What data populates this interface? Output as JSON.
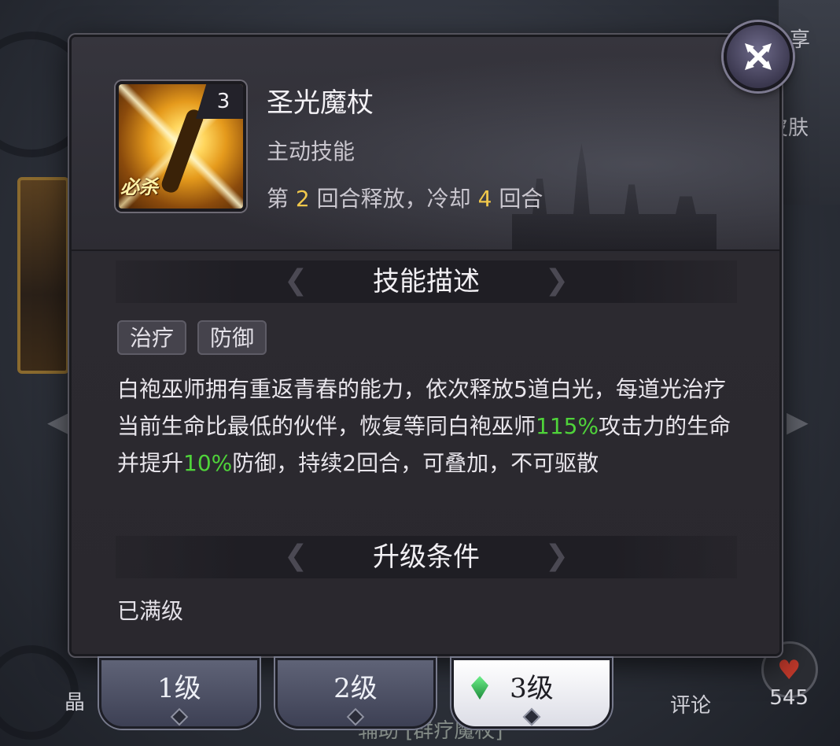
{
  "background": {
    "share_label": "享",
    "skin_label": "皮肤",
    "crystal_label": "晶",
    "comment_label": "评论",
    "likes_count": "545",
    "footer_text": "辅助 [群疗魔杖]"
  },
  "skill": {
    "name": "圣光魔杖",
    "type": "主动技能",
    "level_badge": "3",
    "icon_tag": "必杀",
    "icon": "holy-staff-icon",
    "cooldown": {
      "prefix": "第",
      "release_round": "2",
      "mid": "回合释放，冷却",
      "cooldown_rounds": "4",
      "suffix": "回合"
    }
  },
  "description_section": {
    "title": "技能描述",
    "tags": [
      "治疗",
      "防御"
    ],
    "text_1": "白袍巫师拥有重返青春的能力，依次释放5道白光，每道光治疗当前生命比最低的伙伴，恢复等同白袍巫师",
    "highlight_1": "115%",
    "text_2": "攻击力的生命并提升",
    "highlight_2": "10%",
    "text_3": "防御，持续2回合，可叠加，不可驱散"
  },
  "upgrade_section": {
    "title": "升级条件",
    "text": "已满级"
  },
  "tabs": [
    {
      "label": "1级",
      "active": false
    },
    {
      "label": "2级",
      "active": false
    },
    {
      "label": "3级",
      "active": true
    }
  ],
  "colors": {
    "highlight_green": "#4fd33a",
    "number_gold": "#f1c84b",
    "panel": "#2b2a31"
  }
}
